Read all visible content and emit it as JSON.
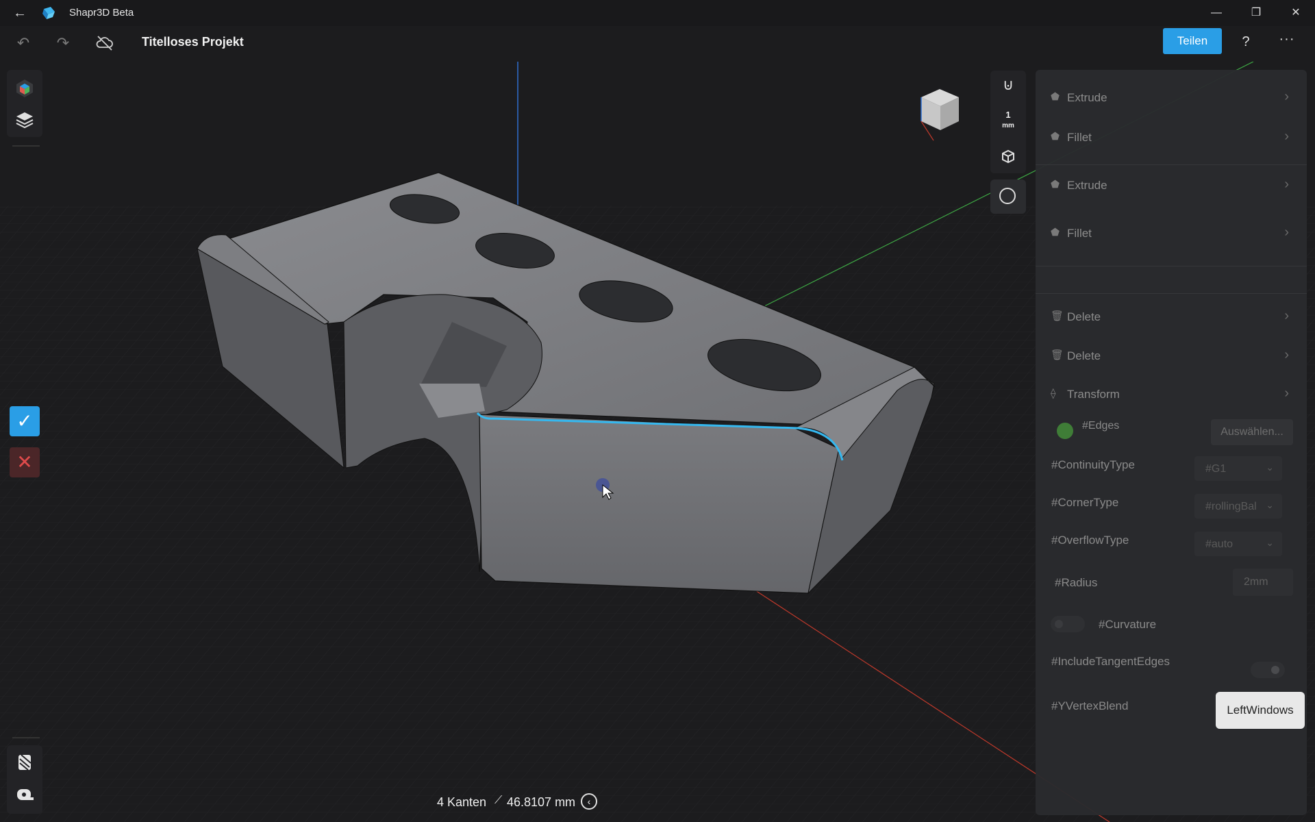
{
  "titlebar": {
    "app_name": "Shapr3D Beta",
    "minimize": "—",
    "restore": "❐",
    "close": "✕"
  },
  "toolbar": {
    "undo": "↶",
    "redo": "↷",
    "project_title": "Titelloses Projekt",
    "share_label": "Teilen",
    "help_label": "?",
    "more_label": "···"
  },
  "right_tools": {
    "grid_value": "1",
    "grid_unit": "mm"
  },
  "panel": {
    "history": [
      {
        "icon": "extrude-icon",
        "label": "Extrude"
      },
      {
        "icon": "fillet-icon",
        "label": "Fillet"
      },
      {
        "icon": "extrude-icon",
        "label": "Extrude"
      },
      {
        "icon": "fillet-icon",
        "label": "Fillet"
      },
      {
        "icon": "delete-icon",
        "label": "Delete"
      },
      {
        "icon": "delete-icon",
        "label": "Delete"
      },
      {
        "icon": "transform-icon",
        "label": "Transform"
      }
    ],
    "edges_label": "#Edges",
    "select_button": "Auswählen...",
    "continuity_label": "#ContinuityType",
    "continuity_value": "#G1",
    "corner_label": "#CornerType",
    "corner_value": "#rollingBal",
    "overflow_label": "#OverflowType",
    "overflow_value": "#auto",
    "radius_label": "#Radius",
    "radius_value": "2mm",
    "curvature_label": "#Curvature",
    "tangent_label": "#IncludeTangentEdges",
    "yvertex_label": "#YVertexBlend",
    "tooltip": "LeftWindows"
  },
  "status": {
    "edge_count": "4 Kanten",
    "length": "46.8107 mm"
  },
  "colors": {
    "accent": "#2a9ee6",
    "selection": "#35b8ef",
    "x_axis": "#c0392b",
    "y_axis": "#3fae46",
    "z_axis": "#2f6fd0"
  }
}
